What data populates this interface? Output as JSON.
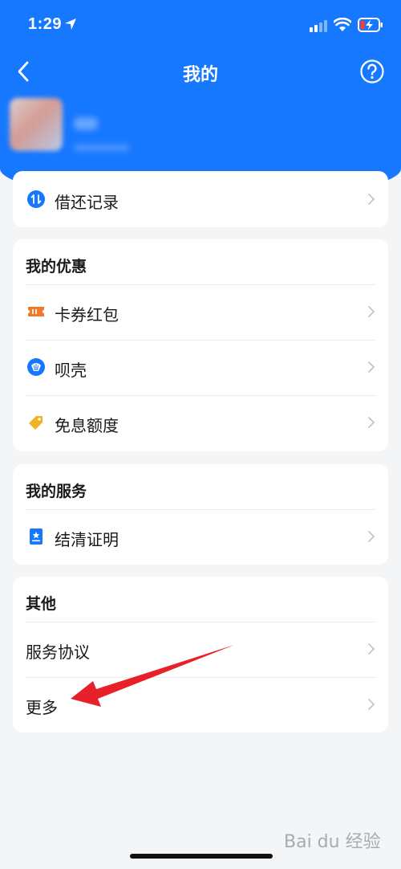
{
  "status_bar": {
    "time": "1:29"
  },
  "nav": {
    "title": "我的"
  },
  "records": {
    "label": "借还记录"
  },
  "discounts": {
    "title": "我的优惠",
    "items": [
      {
        "label": "卡券红包",
        "icon": "coupon-icon",
        "color": "#f07a2a"
      },
      {
        "label": "呗壳",
        "icon": "shell-icon",
        "color": "#1677ff"
      },
      {
        "label": "免息额度",
        "icon": "tag-icon",
        "color": "#f0b323"
      }
    ]
  },
  "services": {
    "title": "我的服务",
    "items": [
      {
        "label": "结清证明",
        "icon": "certificate-icon",
        "color": "#1677ff"
      }
    ]
  },
  "other": {
    "title": "其他",
    "items": [
      {
        "label": "服务协议"
      },
      {
        "label": "更多"
      }
    ]
  },
  "watermark": "Bai du 经验",
  "colors": {
    "brand": "#1677ff",
    "arrow": "#e8202a"
  }
}
